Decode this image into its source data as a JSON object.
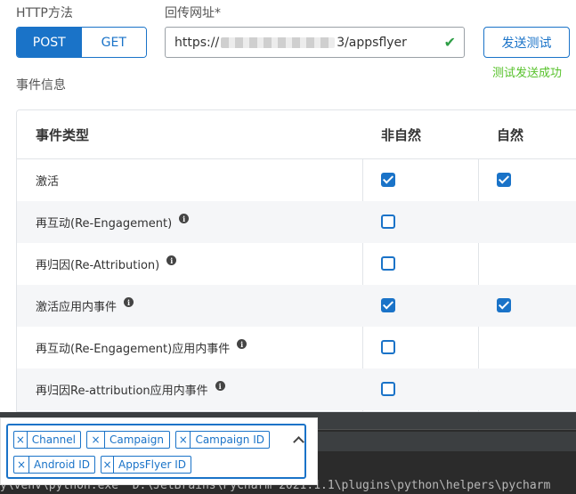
{
  "form": {
    "http_method_label": "HTTP方法",
    "methods": [
      "POST",
      "GET"
    ],
    "selected_method": "POST",
    "callback_url_label": "回传网址*",
    "callback_url_prefix": "https://",
    "callback_url_suffix": "3/appsflyer",
    "send_test_label": "发送测试",
    "send_status": "测试发送成功",
    "event_info_label": "事件信息"
  },
  "event_table": {
    "headers": [
      "事件类型",
      "非自然",
      "自然"
    ],
    "rows": [
      {
        "name": "激活",
        "info": false,
        "non_organic": true,
        "organic": true
      },
      {
        "name": "再互动(Re-Engagement)",
        "info": true,
        "non_organic": false,
        "organic": null
      },
      {
        "name": "再归因(Re-Attribution)",
        "info": true,
        "non_organic": false,
        "organic": null
      },
      {
        "name": "激活应用内事件",
        "info": true,
        "non_organic": true,
        "organic": true
      },
      {
        "name": "再互动(Re-Engagement)应用内事件",
        "info": true,
        "non_organic": false,
        "organic": null
      },
      {
        "name": "再归因Re-attribution应用内事件",
        "info": true,
        "non_organic": false,
        "organic": null
      }
    ]
  },
  "tag_select": {
    "tags": [
      "Channel",
      "Campaign",
      "Campaign ID",
      "Android ID",
      "AppsFlyer ID"
    ],
    "remove_glyph": "×"
  },
  "terminal": {
    "line": "y\\venv\\python.exe \"D:\\JetBrains\\PyCharm 2021.1.1\\plugins\\python\\helpers\\pycharm"
  },
  "icons": {
    "valid": "check-icon",
    "info": "info-icon",
    "collapse": "chevron-up-icon"
  },
  "colors": {
    "primary": "#1a73c8",
    "success_text": "#57c22b",
    "valid_check": "#2e9e46"
  }
}
